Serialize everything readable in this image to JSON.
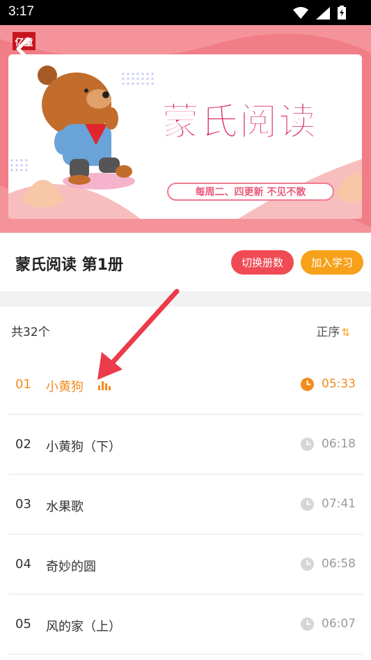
{
  "status_bar": {
    "time": "3:17"
  },
  "banner": {
    "logo_text": "亿童",
    "title": "蒙氏阅读",
    "subtitle": "每周二、四更新  不见不散",
    "brand_color": "#d8246b"
  },
  "header": {
    "book_title": "蒙氏阅读 第1册",
    "switch_button": "切换册数",
    "join_button": "加入学习"
  },
  "list": {
    "count_label": "共32个",
    "sort_label": "正序",
    "tracks": [
      {
        "num": "01",
        "name": "小黄狗",
        "duration": "05:33",
        "playing": true
      },
      {
        "num": "02",
        "name": "小黄狗（下）",
        "duration": "06:18",
        "playing": false
      },
      {
        "num": "03",
        "name": "水果歌",
        "duration": "07:41",
        "playing": false
      },
      {
        "num": "04",
        "name": "奇妙的圆",
        "duration": "06:58",
        "playing": false
      },
      {
        "num": "05",
        "name": "风的家（上）",
        "duration": "06:07",
        "playing": false
      }
    ]
  },
  "colors": {
    "accent_orange": "#f28c1c",
    "switch_red": "#f04b55",
    "join_orange": "#f7a11a",
    "banner_pink": "#f17d86"
  },
  "icons": [
    "back-arrow-icon",
    "wifi-icon",
    "signal-icon",
    "battery-icon",
    "clock-icon",
    "equalizer-icon",
    "sort-arrows-icon"
  ]
}
